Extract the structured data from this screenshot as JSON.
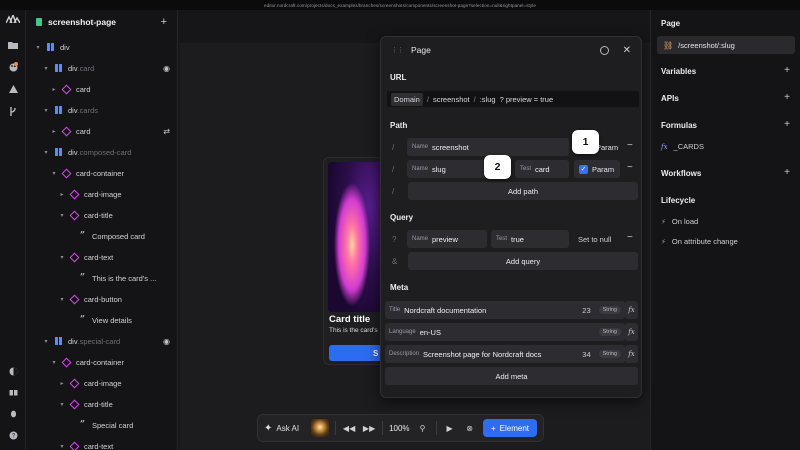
{
  "browser": {
    "url": "editor.nordcraft.com/projects/docs_examples/branches/screenshots/components/screenshot-page?selection=null&rightpanel=style"
  },
  "tree": {
    "title": "screenshot-page",
    "rows": [
      {
        "label": "div",
        "cls": ""
      },
      {
        "label": "div",
        "cls": ".card"
      },
      {
        "label": "card",
        "cls": ""
      },
      {
        "label": "div",
        "cls": ".cards"
      },
      {
        "label": "card",
        "cls": ""
      },
      {
        "label": "div",
        "cls": ".composed-card"
      },
      {
        "label": "card-container",
        "cls": ""
      },
      {
        "label": "card-image",
        "cls": ""
      },
      {
        "label": "card-title",
        "cls": ""
      },
      {
        "label": "Composed card",
        "cls": ""
      },
      {
        "label": "card-text",
        "cls": ""
      },
      {
        "label": "This is the card's ...",
        "cls": ""
      },
      {
        "label": "card-button",
        "cls": ""
      },
      {
        "label": "View details",
        "cls": ""
      },
      {
        "label": "div",
        "cls": ".special-card"
      },
      {
        "label": "card-container",
        "cls": ""
      },
      {
        "label": "card-image",
        "cls": ""
      },
      {
        "label": "card-title",
        "cls": ""
      },
      {
        "label": "Special card",
        "cls": ""
      },
      {
        "label": "card-text",
        "cls": ""
      }
    ]
  },
  "preview_card": {
    "title": "Card title",
    "text": "This is the card's",
    "button": "S"
  },
  "modal": {
    "title": "Page",
    "url_section": "URL",
    "url_parts": {
      "domain": "Domain",
      "sep": "/",
      "path1": "screenshot",
      "path2": ":slug",
      "query": "? preview = true"
    },
    "path_section": "Path",
    "path_rows": [
      {
        "slash": "/",
        "name_label": "Name",
        "name_value": "screenshot",
        "param_label": "Param"
      },
      {
        "slash": "/",
        "name_label": "Name",
        "name_value": "slug",
        "test_label": "Test",
        "test_value": "card",
        "param_label": "Param",
        "param_checked": true
      }
    ],
    "add_path": "Add path",
    "add_path_slash": "/",
    "query_section": "Query",
    "query_row": {
      "prefix": "?",
      "name_label": "Name",
      "name_value": "preview",
      "test_label": "Test",
      "test_value": "true",
      "set_null": "Set to null"
    },
    "add_query_prefix": "&",
    "add_query": "Add query",
    "meta_section": "Meta",
    "meta_rows": [
      {
        "label": "Title",
        "value": "Nordcraft documentation",
        "count": "23",
        "type": "String"
      },
      {
        "label": "Language",
        "value": "en-US",
        "count": "",
        "type": "String"
      },
      {
        "label": "Description",
        "value": "Screenshot page for Nordcraft docs",
        "count": "34",
        "type": "String"
      }
    ],
    "fx_label": "fx",
    "add_meta": "Add meta"
  },
  "badges": {
    "one": "1",
    "two": "2"
  },
  "toolbar": {
    "ask_ai": "Ask AI",
    "zoom": "100%",
    "add_element": "Element"
  },
  "inspector": {
    "page_title": "Page",
    "page_value": "/screenshot/:slug",
    "variables": "Variables",
    "apis": "APIs",
    "formulas": "Formulas",
    "formula_item": "_CARDS",
    "workflows": "Workflows",
    "lifecycle": "Lifecycle",
    "on_load": "On load",
    "on_attr": "On attribute change"
  },
  "colors": {
    "accent": "#2f6df0",
    "component": "#d946ef",
    "div": "#5b8cff",
    "badge_bg": "#ffffff"
  }
}
